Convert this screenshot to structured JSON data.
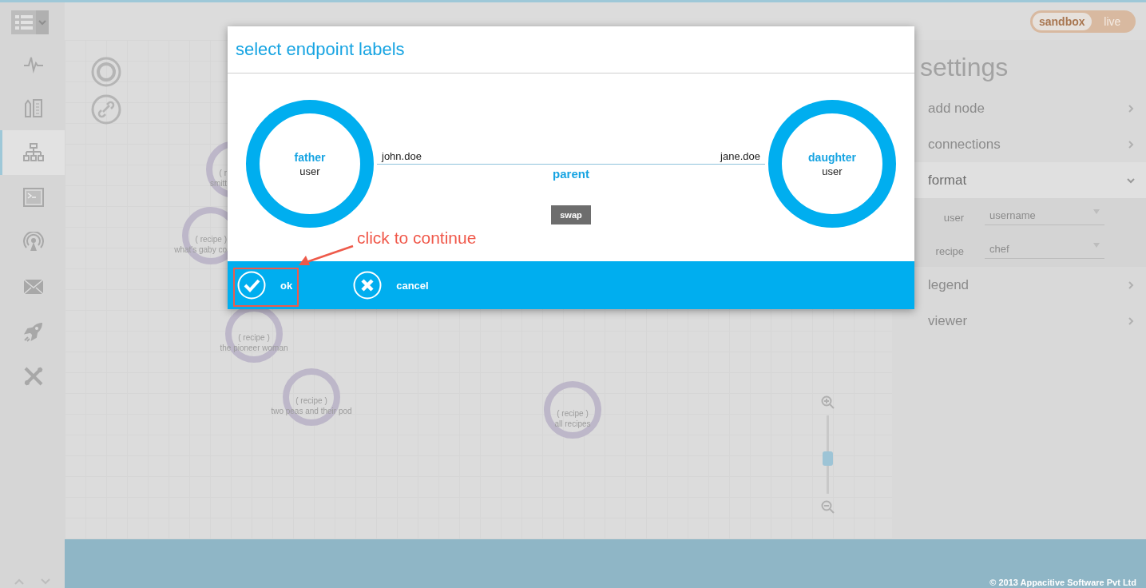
{
  "sidebar": {
    "items": [
      {
        "kind": "pulse",
        "selected": false
      },
      {
        "kind": "schema",
        "selected": false
      },
      {
        "kind": "tree",
        "selected": true
      },
      {
        "kind": "console",
        "selected": false
      },
      {
        "kind": "broadcast",
        "selected": false
      },
      {
        "kind": "mail",
        "selected": false
      },
      {
        "kind": "rocket",
        "selected": false
      },
      {
        "kind": "tools",
        "selected": false
      }
    ]
  },
  "header": {
    "mode_toggle": [
      {
        "label": "sandbox",
        "selected": true
      },
      {
        "label": "live",
        "selected": false
      }
    ]
  },
  "canvas": {
    "nodes": [
      {
        "kind": "cut",
        "type": "( r",
        "name": "smitt"
      },
      {
        "kind": "cut",
        "type": "( recipe )",
        "name": "what's gaby co"
      },
      {
        "kind": "whole",
        "type": "( recipe )",
        "name": "the pioneer woman"
      },
      {
        "kind": "whole",
        "type": "( recipe )",
        "name": "two peas and their pod"
      },
      {
        "kind": "whole",
        "type": "( recipe )",
        "name": "all recipes"
      }
    ],
    "zoom": {
      "level": 0.44
    }
  },
  "settings": {
    "title": "settings",
    "sections": [
      {
        "label": "add node",
        "expanded": false
      },
      {
        "label": "connections",
        "expanded": false
      },
      {
        "label": "format",
        "expanded": true,
        "fields": [
          {
            "label": "user",
            "value": "username"
          },
          {
            "label": "recipe",
            "value": "chef"
          }
        ]
      },
      {
        "label": "legend",
        "expanded": false
      },
      {
        "label": "viewer",
        "expanded": false
      }
    ]
  },
  "dialog": {
    "title": "select endpoint labels",
    "endpoints": [
      {
        "label": "father",
        "type": "user",
        "id": "john.doe"
      },
      {
        "label": "daughter",
        "type": "user",
        "id": "jane.doe"
      }
    ],
    "relation": "parent",
    "swap": "swap",
    "buttons": [
      {
        "kind": "ok",
        "label": "ok"
      },
      {
        "kind": "cancel",
        "label": "cancel"
      }
    ]
  },
  "annotation": {
    "text": "click to continue"
  },
  "footer": {
    "copyright": "© 2013 Appacitive Software Pvt Ltd"
  }
}
